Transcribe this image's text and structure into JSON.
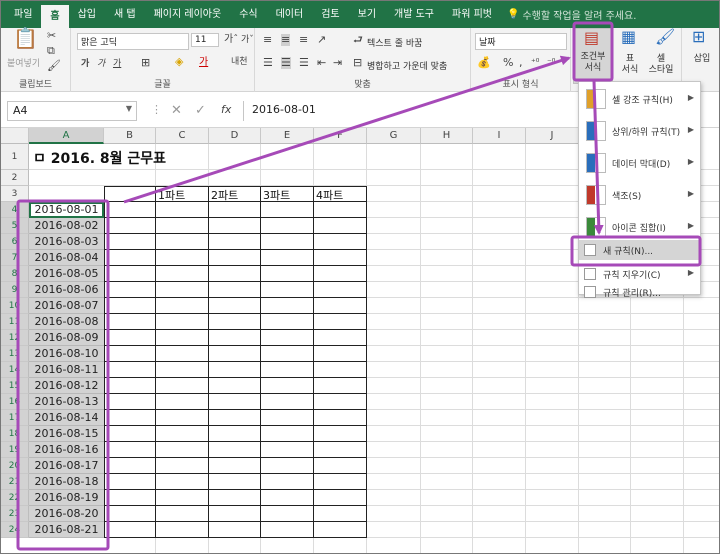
{
  "menu_tabs": [
    {
      "label": "파일",
      "active": false
    },
    {
      "label": "홈",
      "active": true
    },
    {
      "label": "삽입",
      "active": false
    },
    {
      "label": "새 탭",
      "active": false
    },
    {
      "label": "페이지 레이아웃",
      "active": false
    },
    {
      "label": "수식",
      "active": false
    },
    {
      "label": "데이터",
      "active": false
    },
    {
      "label": "검토",
      "active": false
    },
    {
      "label": "보기",
      "active": false
    },
    {
      "label": "개발 도구",
      "active": false
    },
    {
      "label": "파워 피벗",
      "active": false
    }
  ],
  "tell_me": "수행할 작업을 알려 주세요.",
  "ribbon": {
    "clipboard": {
      "paste_label": "붙여넣기",
      "group_label": "클립보드"
    },
    "font": {
      "font_name": "맑은 고딕",
      "font_size": "11",
      "group_label": "글꼴"
    },
    "alignment": {
      "wrap_text": "텍스트 줄 바꿈",
      "merge_center": "병합하고 가운데 맞춤",
      "group_label": "맞춤"
    },
    "number": {
      "format": "날짜",
      "percent": "%",
      "comma": ",",
      "group_label": "표시 형식"
    },
    "styles": {
      "conditional_formatting": "조건부\n서식",
      "format_table": "표\n서식",
      "cell_styles": "셀\n스타일"
    },
    "cells": {
      "insert_label": "삽입"
    }
  },
  "formula_bar": {
    "name_box": "A4",
    "fx": "fx",
    "value": "2016-08-01"
  },
  "columns": [
    "A",
    "B",
    "C",
    "D",
    "E",
    "F",
    "G",
    "H",
    "I",
    "J"
  ],
  "rows": [
    "1",
    "2",
    "3",
    "4",
    "5",
    "6",
    "7",
    "8",
    "9",
    "10",
    "11",
    "12",
    "13",
    "14",
    "15",
    "16",
    "17",
    "18",
    "19",
    "20",
    "21",
    "22",
    "23",
    "24"
  ],
  "sheet": {
    "title": "ㅁ 2016. 8월 근무표",
    "part_headers": [
      "1파트",
      "2파트",
      "3파트",
      "4파트"
    ],
    "dates": [
      "2016-08-01",
      "2016-08-02",
      "2016-08-03",
      "2016-08-04",
      "2016-08-05",
      "2016-08-06",
      "2016-08-07",
      "2016-08-08",
      "2016-08-09",
      "2016-08-10",
      "2016-08-11",
      "2016-08-12",
      "2016-08-13",
      "2016-08-14",
      "2016-08-15",
      "2016-08-16",
      "2016-08-17",
      "2016-08-18",
      "2016-08-19",
      "2016-08-20",
      "2016-08-21"
    ]
  },
  "dropdown": {
    "items": [
      {
        "label": "셀 강조 규칙(H)",
        "icon": "highlight-cells-icon",
        "submenu": true
      },
      {
        "label": "상위/하위 규칙(T)",
        "icon": "top-bottom-icon",
        "submenu": true
      },
      {
        "label": "데이터 막대(D)",
        "icon": "data-bars-icon",
        "submenu": true
      },
      {
        "label": "색조(S)",
        "icon": "color-scales-icon",
        "submenu": true
      },
      {
        "label": "아이콘 집합(I)",
        "icon": "icon-sets-icon",
        "submenu": true
      }
    ],
    "small_items": [
      {
        "label": "새 규칙(N)...",
        "icon": "new-rule-icon",
        "highlighted": true
      },
      {
        "label": "규칙 지우기(C)",
        "icon": "clear-rules-icon",
        "submenu": true
      },
      {
        "label": "규칙 관리(R)...",
        "icon": "manage-rules-icon"
      }
    ]
  },
  "colors": {
    "excel_green": "#217346",
    "annotation_purple": "#a64ab8",
    "selection_gray": "#d2d2d2"
  }
}
